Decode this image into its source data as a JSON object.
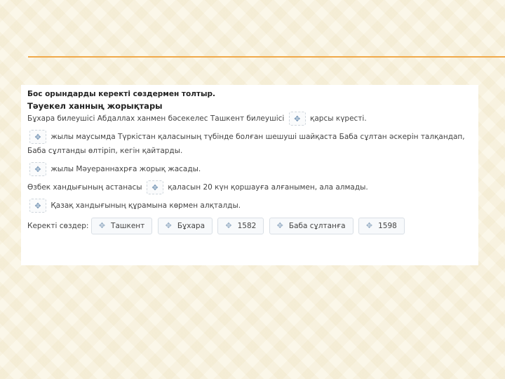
{
  "instruction": "Бос орындарды керекті сөздермен толтыр.",
  "exercise_title": "Тәуекел ханның жорықтары",
  "drag_icon": "move-arrows-icon",
  "sentences": [
    {
      "before": "Бұхара билеушісі Абдаллах ханмен бәсекелес Ташкент билеушісі",
      "after": "қарсы күресті."
    },
    {
      "before": "",
      "after": "жылы маусымда Түркістан қаласының түбінде болған шешуші шайқаста Баба сұлтан әскерін талқандап, Баба сұлтанды өлтіріп, кегін қайтарды."
    },
    {
      "before": "",
      "after": "жылы Мәуераннахрға жорық жасады."
    },
    {
      "before": "Өзбек хандығының астанасы",
      "after": "қаласын 20 күн қоршауға алғанымен, алa алмады."
    },
    {
      "before": "",
      "after": "Қазақ хандығының құрамына көрмен алқталды."
    }
  ],
  "word_bank_label": "Керекті сөздер:",
  "word_bank": [
    "Ташкент",
    "Бұхара",
    "1582",
    "Баба сұлтанға",
    "1598"
  ]
}
